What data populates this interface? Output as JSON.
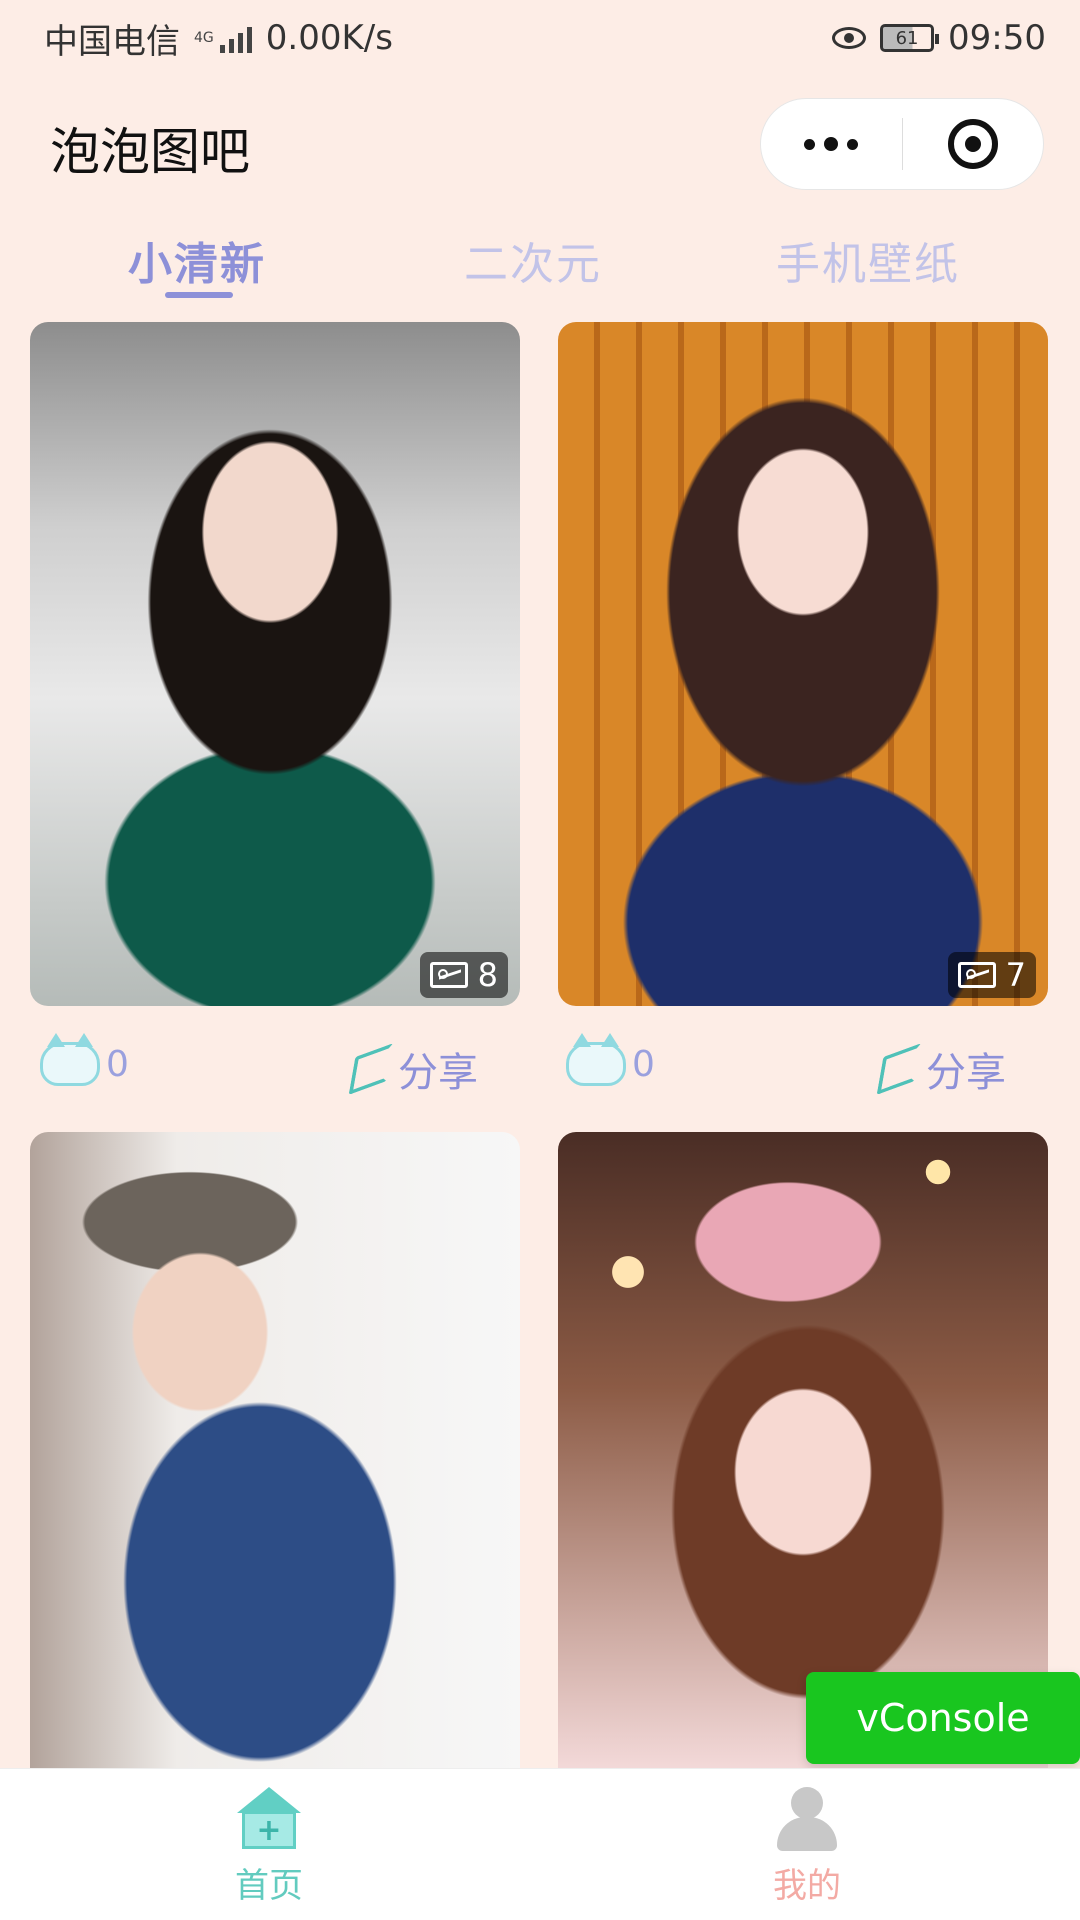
{
  "status_bar": {
    "carrier": "中国电信",
    "network": "4G",
    "speed": "0.00K/s",
    "battery": "61",
    "time": "09:50"
  },
  "header": {
    "title": "泡泡图吧"
  },
  "tabs": [
    {
      "label": "小清新",
      "active": true
    },
    {
      "label": "二次元",
      "active": false
    },
    {
      "label": "手机壁纸",
      "active": false
    }
  ],
  "cards": [
    {
      "photo_count": "8",
      "likes": "0",
      "share_label": "分享"
    },
    {
      "photo_count": "7",
      "likes": "0",
      "share_label": "分享"
    },
    {
      "photo_count": "",
      "likes": "",
      "share_label": ""
    },
    {
      "photo_count": "",
      "likes": "",
      "share_label": ""
    }
  ],
  "bottom_nav": {
    "items": [
      {
        "label": "首页",
        "icon": "home-icon"
      },
      {
        "label": "我的",
        "icon": "user-icon"
      }
    ]
  },
  "overlay": {
    "vconsole_label": "vConsole"
  },
  "colors": {
    "background": "#fdede6",
    "active_tab": "#8d90d8",
    "inactive_tab": "#c2c3e8",
    "vconsole": "#19c61f",
    "nav_active": "#62cbbf",
    "nav_inactive": "#f3aaa4"
  }
}
